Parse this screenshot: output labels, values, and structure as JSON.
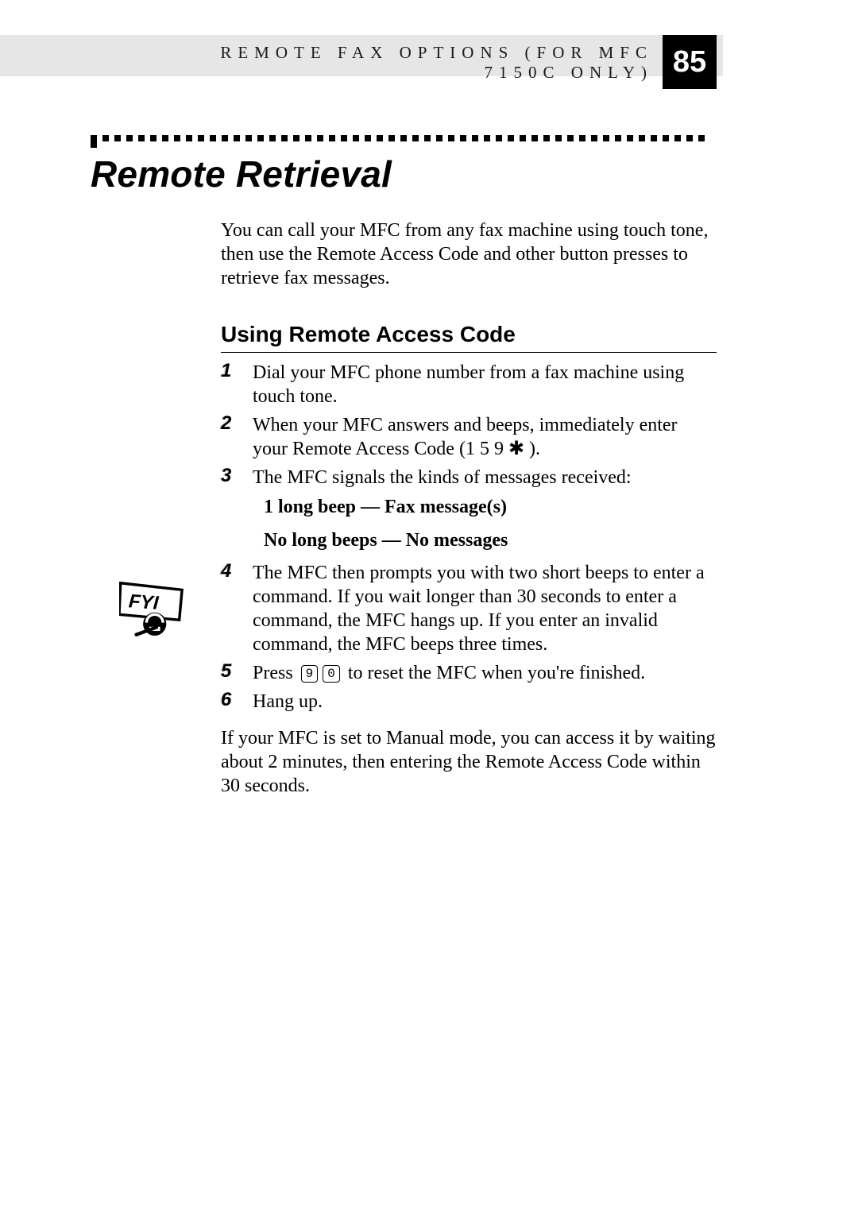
{
  "header": {
    "running_head": "REMOTE FAX OPTIONS (FOR MFC 7150C ONLY)",
    "page_number": "85"
  },
  "title": "Remote Retrieval",
  "intro": "You can call your MFC from any fax machine using touch tone, then use the Remote Access Code and other button presses to retrieve fax messages.",
  "section_heading": "Using Remote Access Code",
  "steps": {
    "s1": {
      "n": "1",
      "text": "Dial your MFC phone number from a fax machine using touch tone."
    },
    "s2": {
      "n": "2",
      "text_a": "When your MFC answers and beeps, immediately enter your Remote Access Code (1 5 9 ",
      "star": "✱",
      "text_b": " )."
    },
    "s3": {
      "n": "3",
      "text": "The MFC signals the kinds of messages received:",
      "line1": "1 long beep — Fax message(s)",
      "line2": "No long beeps — No messages"
    },
    "s4": {
      "n": "4",
      "text": "The MFC then prompts you with two short beeps to enter a command. If you wait longer than 30 seconds to enter a command, the MFC hangs up.  If you enter an invalid command, the MFC beeps three times."
    },
    "s5": {
      "n": "5",
      "text_a": "Press ",
      "key1": "9",
      "key2": "0",
      "text_b": " to reset the MFC when you're finished."
    },
    "s6": {
      "n": "6",
      "text": "Hang up."
    }
  },
  "note": "If your MFC is set to Manual mode, you can access it by waiting about 2 minutes, then entering the Remote Access Code within 30 seconds.",
  "icons": {
    "fyi": "fyi-icon"
  }
}
